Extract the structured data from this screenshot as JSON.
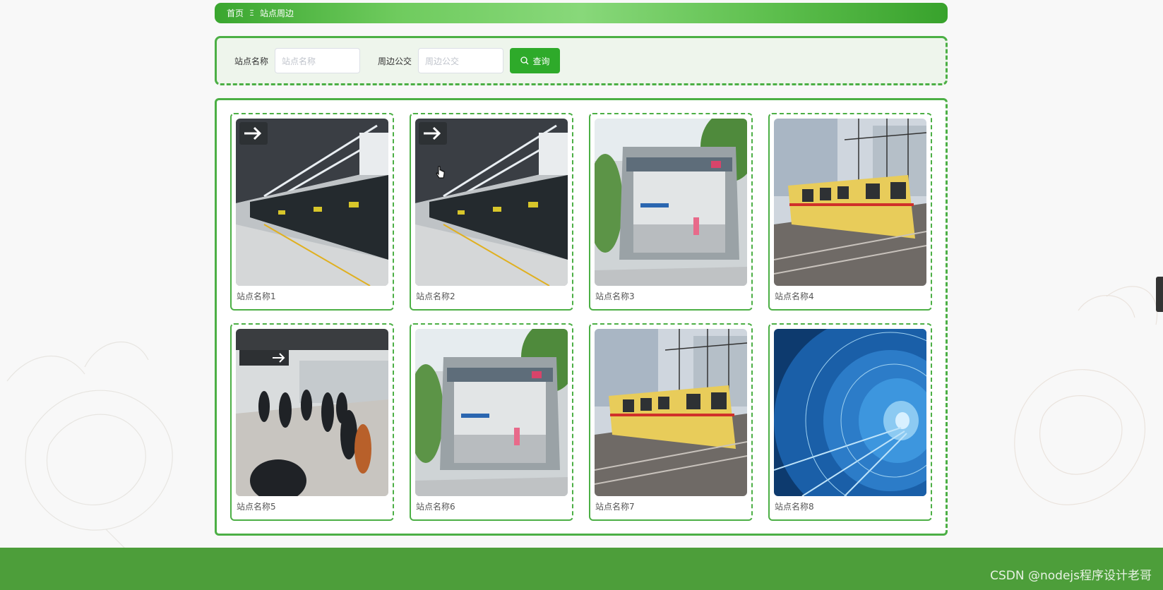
{
  "breadcrumb": {
    "home": "首页",
    "separator": "Ξ",
    "current": "站点周边"
  },
  "search": {
    "station_label": "站点名称",
    "station_placeholder": "站点名称",
    "bus_label": "周边公交",
    "bus_placeholder": "周边公交",
    "button_label": "查询"
  },
  "cards": [
    {
      "title": "站点名称1",
      "image": "metro-platform-photo"
    },
    {
      "title": "站点名称2",
      "image": "metro-platform-photo"
    },
    {
      "title": "站点名称3",
      "image": "metro-entrance-photo"
    },
    {
      "title": "站点名称4",
      "image": "yellow-train-photo"
    },
    {
      "title": "站点名称5",
      "image": "crowded-platform-photo"
    },
    {
      "title": "站点名称6",
      "image": "metro-entrance-photo"
    },
    {
      "title": "站点名称7",
      "image": "yellow-train-photo"
    },
    {
      "title": "站点名称8",
      "image": "blue-tunnel-photo"
    }
  ],
  "footer": {
    "watermark": "CSDN @nodejs程序设计老哥"
  },
  "colors": {
    "accent": "#4caf45",
    "button": "#2eaa2a",
    "footer": "#4d9e3a"
  }
}
